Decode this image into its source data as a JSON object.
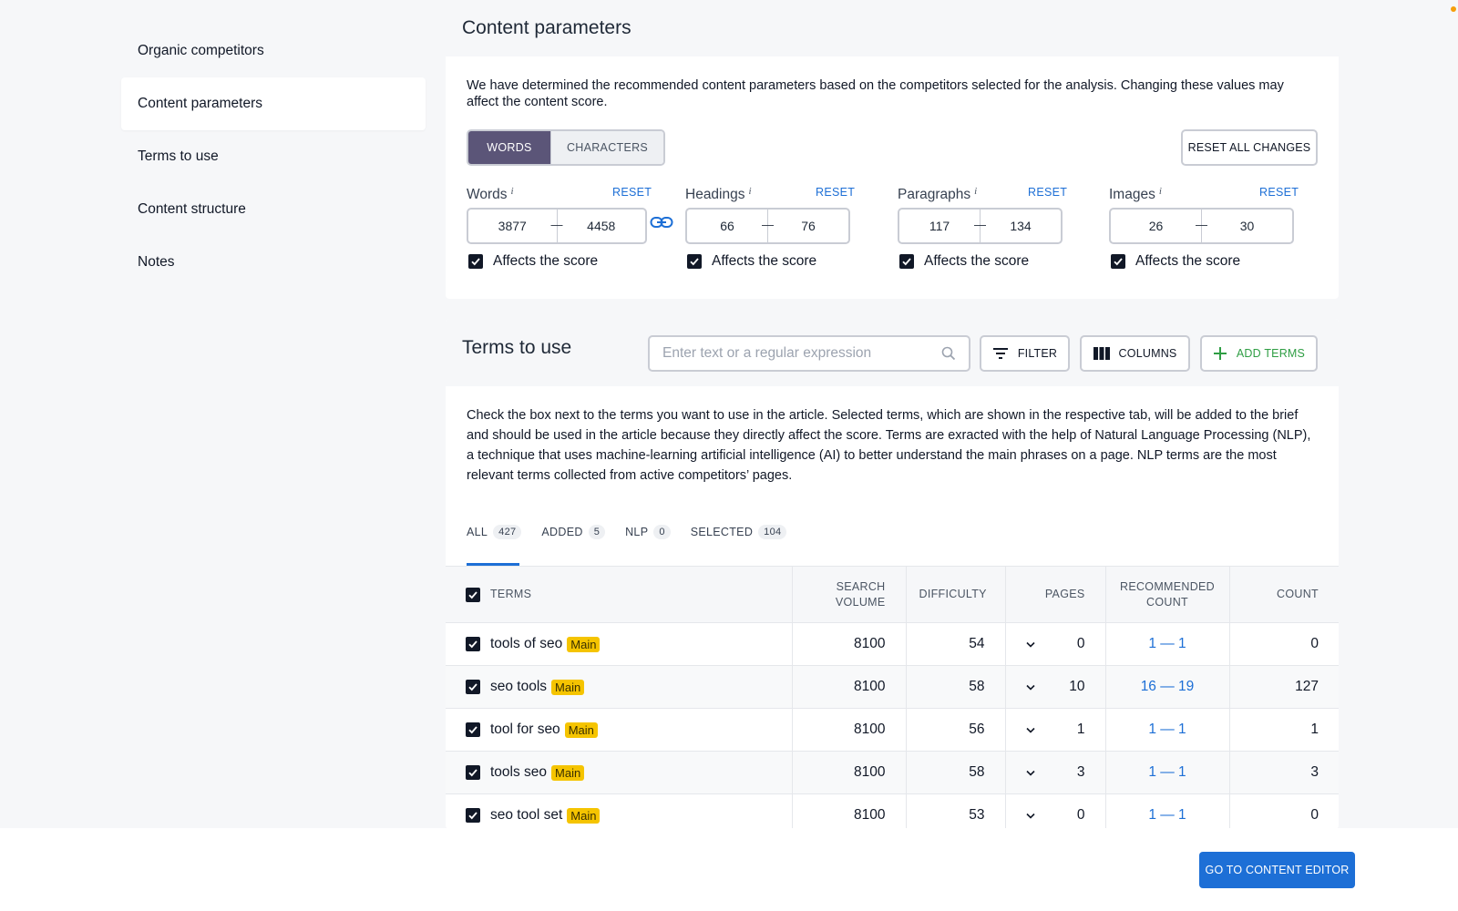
{
  "sidebar": {
    "items": [
      {
        "label": "Organic competitors"
      },
      {
        "label": "Content parameters"
      },
      {
        "label": "Terms to use"
      },
      {
        "label": "Content structure"
      },
      {
        "label": "Notes"
      }
    ],
    "active_index": 1
  },
  "params": {
    "title": "Content parameters",
    "description": "We have determined the recommended content parameters based on the competitors selected for the analysis. Changing these values may affect the content score.",
    "toggle": {
      "words": "WORDS",
      "characters": "CHARACTERS",
      "selected": "WORDS"
    },
    "reset_all": "RESET ALL CHANGES",
    "reset_label": "RESET",
    "info_glyph": "i",
    "affects_label": "Affects the score",
    "items": [
      {
        "label": "Words",
        "min": "3877",
        "max": "4458",
        "affects": true
      },
      {
        "label": "Headings",
        "min": "66",
        "max": "76",
        "affects": true
      },
      {
        "label": "Paragraphs",
        "min": "117",
        "max": "134",
        "affects": true
      },
      {
        "label": "Images",
        "min": "26",
        "max": "30",
        "affects": true
      }
    ]
  },
  "terms": {
    "title": "Terms to use",
    "search_placeholder": "Enter text or a regular expression",
    "filter": "FILTER",
    "columns": "COLUMNS",
    "add_terms": "ADD TERMS",
    "description": "Check the box next to the terms you want to use in the article. Selected terms, which are shown in the respective tab, will be added to the brief and should be used in the article because they directly affect the score. Terms are exracted with the help of Natural Language Processing (NLP), a technique that uses machine-learning artificial intelligence (AI) to better understand the main phrases on a page. NLP terms are the most relevant terms collected from active competitors’ pages.",
    "tabs": [
      {
        "label": "ALL",
        "count": "427"
      },
      {
        "label": "ADDED",
        "count": "5"
      },
      {
        "label": "NLP",
        "count": "0"
      },
      {
        "label": "SELECTED",
        "count": "104"
      }
    ],
    "columns_header": {
      "terms": "TERMS",
      "search_volume_1": "SEARCH",
      "search_volume_2": "VOLUME",
      "difficulty": "DIFFICULTY",
      "pages": "PAGES",
      "recommended_1": "RECOMMENDED",
      "recommended_2": "COUNT",
      "count": "COUNT"
    },
    "badge": "Main",
    "rows": [
      {
        "term": "tools of seo",
        "volume": "8100",
        "difficulty": "54",
        "pages": "0",
        "recommended": "1 — 1",
        "count": "0"
      },
      {
        "term": "seo tools",
        "volume": "8100",
        "difficulty": "58",
        "pages": "10",
        "recommended": "16 — 19",
        "count": "127"
      },
      {
        "term": "tool for seo",
        "volume": "8100",
        "difficulty": "56",
        "pages": "1",
        "recommended": "1 — 1",
        "count": "1"
      },
      {
        "term": "tools seo",
        "volume": "8100",
        "difficulty": "58",
        "pages": "3",
        "recommended": "1 — 1",
        "count": "3"
      },
      {
        "term": "seo tool set",
        "volume": "8100",
        "difficulty": "53",
        "pages": "0",
        "recommended": "1 — 1",
        "count": "0"
      }
    ]
  },
  "footer": {
    "go_editor": "GO TO CONTENT EDITOR"
  },
  "colors": {
    "accent": "#1d6fd6",
    "toggle_active": "#5b5578",
    "badge": "#f5c400",
    "add_terms": "#2f9e44"
  }
}
